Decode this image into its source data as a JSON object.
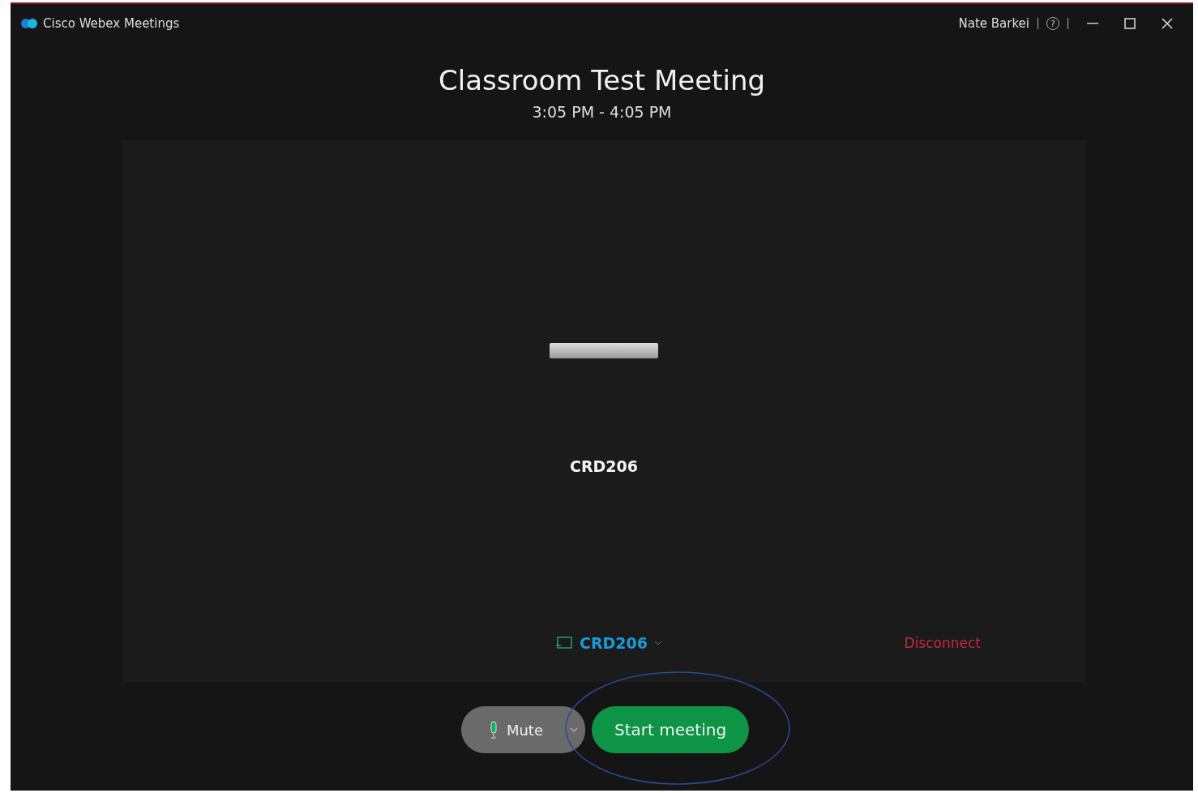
{
  "window": {
    "title": "Cisco Webex Meetings",
    "user": "Nate Barkei",
    "help": "?"
  },
  "meeting": {
    "title": "Classroom Test Meeting",
    "time": "3:05 PM - 4:05 PM"
  },
  "device_panel": {
    "device_name": "CRD206",
    "selector": {
      "name": "CRD206"
    },
    "disconnect": "Disconnect"
  },
  "controls": {
    "mute": {
      "label": "Mute"
    },
    "start": {
      "label": "Start meeting"
    }
  },
  "annotation": {
    "kind": "ellipse",
    "color": "#2c4a9a"
  }
}
